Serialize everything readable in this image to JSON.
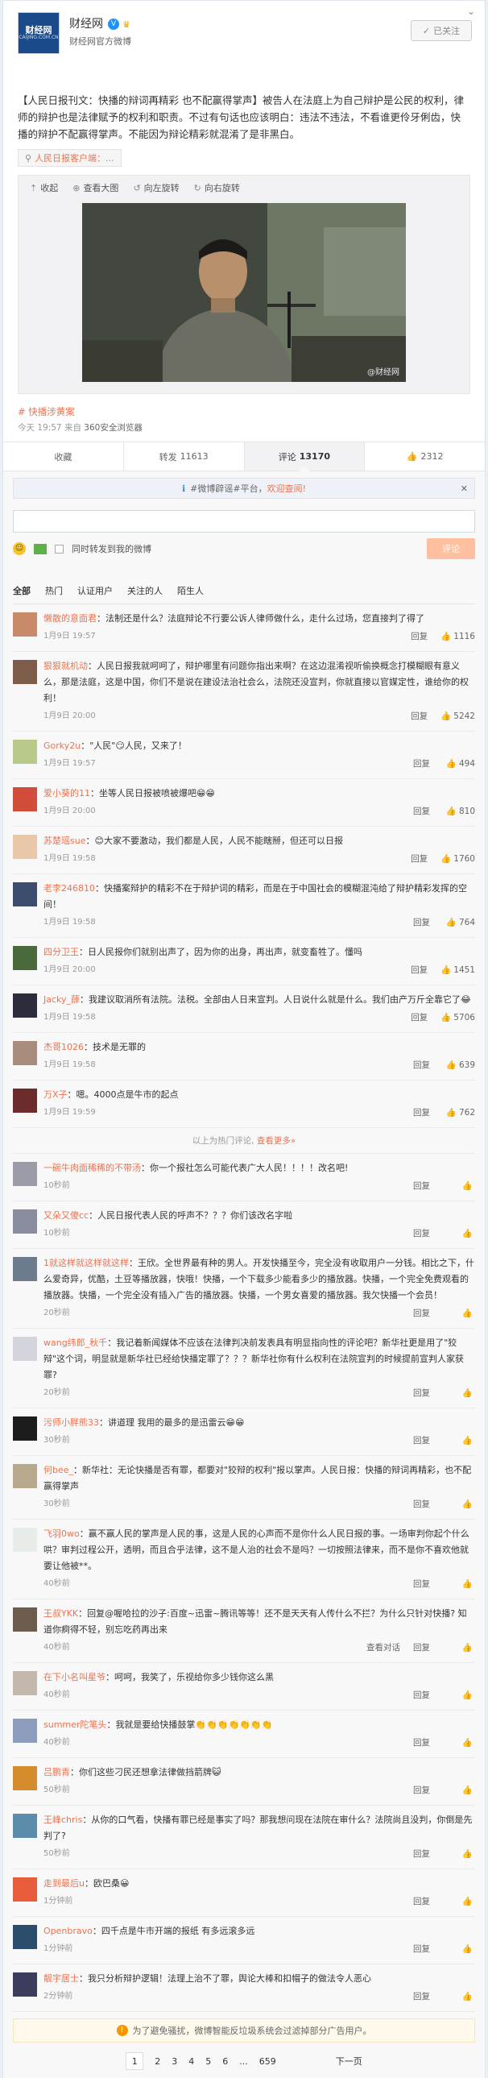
{
  "account": {
    "name": "财经网",
    "logo_text": "财经网",
    "logo_sub": "CAIJING.COM.CN",
    "desc": "财经网官方微博",
    "follow_label": "已关注",
    "follow_icon": "check-icon",
    "menu_icon": "chevron-down-icon"
  },
  "post": {
    "text": "【人民日报刊文：快播的辩词再精彩 也不配赢得掌声】被告人在法庭上为自己辩护是公民的权利，律师的辩护也是法律赋予的权利和职责。不过有句话也应该明白：违法不违法，不看谁更伶牙俐齿，快播的辩护不配赢得掌声。不能因为辩论精彩就混淆了是非黑白。",
    "source_tag": "人民日报客户端：...",
    "tools": [
      "收起",
      "查看大图",
      "向左旋转",
      "向右旋转"
    ],
    "watermark": "@财经网",
    "topic": "快播涉黄案",
    "time": "今天 19:57",
    "from_prefix": "来自",
    "from": "360安全浏览器"
  },
  "actions": {
    "collect": "收藏",
    "repost_label": "转发",
    "repost_count": "11613",
    "comment_label": "评论",
    "comment_count": "13170",
    "like_count": "2312"
  },
  "notice": {
    "prefix": "#微博辟谣#平台，",
    "link": "欢迎查阅!"
  },
  "composer": {
    "also_repost": "同时转发到我的微博",
    "submit": "评论"
  },
  "filters": [
    "全部",
    "热门",
    "认证用户",
    "关注的人",
    "陌生人"
  ],
  "hot_comments": [
    {
      "name": "懒散的意面君",
      "text": "法制还是什么？法庭辩论不行要公诉人律师做什么，走什么过场，您直接判了得了",
      "time": "1月9日 19:57",
      "reply": "回复",
      "likes": "1116",
      "color": "#c98a6a"
    },
    {
      "name": "狠狠就机动",
      "text": "人民日报我就呵呵了，辩护哪里有问题你指出来啊？在这边混淆视听偷换概念打模糊眼有意义么，那是法庭，这是中国，你们不是说在建设法治社会么，法院还没宣判，你就直接以官媒定性，谁给你的权利！",
      "time": "1月9日 20:00",
      "reply": "回复",
      "likes": "5242",
      "color": "#7d5c49"
    },
    {
      "name": "Gorky2u",
      "text": "\"人民\"😏人民，又来了！",
      "time": "1月9日 19:57",
      "reply": "回复",
      "likes": "494",
      "color": "#b8c98a"
    },
    {
      "name": "爱小葵的11",
      "text": "坐等人民日报被喷被爆吧😁😁",
      "time": "1月9日 20:00",
      "reply": "回复",
      "likes": "810",
      "color": "#d24c3c"
    },
    {
      "name": "苏楚瑶sue",
      "text": "😊大家不要激动，我们都是人民，人民不能瞎掰，但还可以日报",
      "time": "1月9日 19:58",
      "reply": "回复",
      "likes": "1760",
      "color": "#e8c8a8"
    },
    {
      "name": "老李246810",
      "text": "快播案辩护的精彩不在于辩护词的精彩，而是在于中国社会的模糊混沌给了辩护精彩发挥的空间！",
      "time": "1月9日 19:58",
      "reply": "回复",
      "likes": "764",
      "color": "#3c4c6c"
    },
    {
      "name": "四分卫王",
      "text": "日人民报你们就别出声了，因为你的出身，再出声，就变畜牲了。懂吗",
      "time": "1月9日 20:00",
      "reply": "回复",
      "likes": "1451",
      "color": "#4a6a3c"
    },
    {
      "name": "Jacky_薛",
      "text": "我建议取消所有法院。法税。全部由人日来宣判。人日说什么就是什么。我们由产万斤全靠它了😂",
      "time": "1月9日 19:58",
      "reply": "回复",
      "likes": "5706",
      "color": "#2c2c3c"
    },
    {
      "name": "杰哥1026",
      "text": "技术是无罪的",
      "time": "1月9日 19:58",
      "reply": "回复",
      "likes": "639",
      "color": "#a88c7c"
    },
    {
      "name": "万X子",
      "text": "嗯。4000点是牛市的起点",
      "time": "1月9日 19:59",
      "reply": "回复",
      "likes": "762",
      "color": "#6c2c2c"
    }
  ],
  "hot_divider": {
    "text": "以上为热门评论,",
    "more": "查看更多»"
  },
  "comments": [
    {
      "name": "一碗牛肉面稀稀的不带汤",
      "text": "你一个报社怎么可能代表广大人民！！！！改名吧!",
      "time": "10秒前",
      "color": "#9c9ca8"
    },
    {
      "name": "又朵又傻cc",
      "text": "人民日报代表人民的呼声不？？？你们该改名字啦",
      "time": "10秒前",
      "color": "#8a8ca0"
    },
    {
      "name": "1就这样就这样就这样",
      "text": "王欣。全世界最有种的男人。开发快播至今，完全没有收取用户一分钱。相比之下，什么爱奇异，优酷，土豆等播放器，快哦！快播，一个下载多少能看多少的播放器。快播，一个完全免费观看的播放器。快播，一个完全没有插入广告的播放器。快播，一个男女喜爱的播放器。我欠快播一个会员！",
      "time": "20秒前",
      "color": "#6c7c8c"
    },
    {
      "name": "wang纬郎_秋千",
      "text": "我记着新闻媒体不应该在法律判决前发表具有明显指向性的评论吧？新华社更是用了\"狡辩\"这个词，明显就是新华社已经给快播定罪了？？？新华社你有什么权利在法院宣判的时候提前宣判人家获罪?",
      "time": "20秒前",
      "color": "#d4d4dc"
    },
    {
      "name": "污师小胖熊33",
      "text": "讲道理 我用的最多的是迅雷云😁😁",
      "time": "30秒前",
      "color": "#1c1c1c"
    },
    {
      "name": "何bee_",
      "text": "新华社：无论快播是否有罪，都要对\"狡辩的权利\"报以掌声。人民日报：快播的辩词再精彩，也不配赢得掌声",
      "time": "30秒前",
      "color": "#b8a88c"
    },
    {
      "name": "飞羽0wo",
      "text": "赢不赢人民的掌声是人民的事，这是人民的心声而不是你什么人民日报的事。一场审判你起个什么哄？审判过程公开，透明，而且合乎法律，这不是人治的社会不是吗？一切按照法律来，而不是你不喜欢他就要让他被**。",
      "time": "40秒前",
      "color": "#e8ece8"
    },
    {
      "name": "王叔YKK",
      "text": "回复@喔哈拉的沙子:百度~迅雷~腾讯等等！还不是天天有人传什么不拦？为什么只针对快播? 知道你痾得不轻，别忘吃药再出来",
      "time": "40秒前",
      "color": "#6c5c4c",
      "extra": "查看对话"
    },
    {
      "name": "在下小名叫星爷",
      "text": "呵呵，我笑了，乐视给你多少钱你这么黑",
      "time": "40秒前",
      "color": "#c4b8ac"
    },
    {
      "name": "summer陀笔头",
      "text": "我就是要给快播鼓掌👏👏👏👏👏👏👏",
      "time": "40秒前",
      "color": "#8c9cbc"
    },
    {
      "name": "吕鹏青",
      "text": "你们这些刁民还想拿法律做挡箭牌😺",
      "time": "50秒前",
      "color": "#d48c2c"
    },
    {
      "name": "王峰chris",
      "text": "从你的口气看，快播有罪已经是事实了吗？那我想问现在法院在审什么？法院尚且没判，你倒是先判了?",
      "time": "50秒前",
      "color": "#5c8cac"
    },
    {
      "name": "走到最后u",
      "text": "欧巴桑😀",
      "time": "1分钟前",
      "color": "#e85c3c"
    },
    {
      "name": "Openbravo",
      "text": "四千点是牛市开端的报纸 有多远滚多远",
      "time": "1分钟前",
      "color": "#2c4c6c"
    },
    {
      "name": "靓宇居士",
      "text": "我只分析辩护逻辑！法理上治不了罪，舆论大棒和扣帽子的做法令人恶心",
      "time": "2分钟前",
      "color": "#3c3c5c"
    }
  ],
  "reply_label": "回复",
  "warning": "为了避免骚扰，微博智能反垃圾系统会过滤掉部分广告用户。",
  "pager": {
    "pages": [
      "1",
      "2",
      "3",
      "4",
      "5",
      "6",
      "...",
      "659"
    ],
    "next": "下一页"
  }
}
